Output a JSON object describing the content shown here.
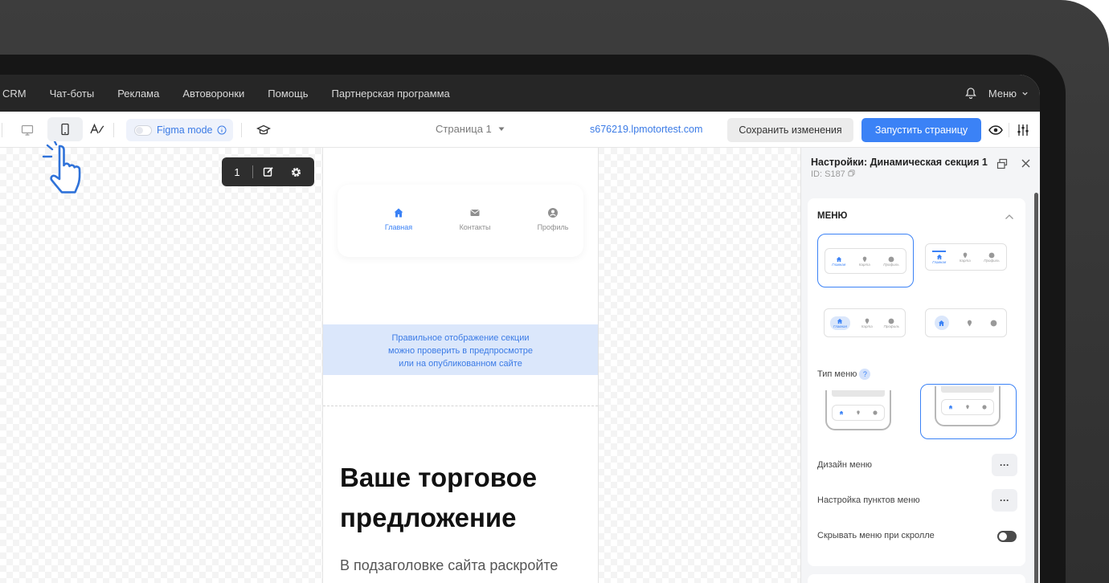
{
  "topnav": {
    "items": [
      "CRM",
      "Чат-боты",
      "Реклама",
      "Автоворонки",
      "Помощь",
      "Партнерская программа"
    ],
    "menu_label": "Меню"
  },
  "toolbar": {
    "figma_mode": "Figma mode",
    "page_select": "Страница 1",
    "domain": "s676219.lpmotortest.com",
    "save_label": "Сохранить изменения",
    "launch_label": "Запустить страницу"
  },
  "float_toolbar": {
    "number": "1"
  },
  "preview": {
    "menu_items": [
      {
        "label": "Главная",
        "icon": "home-icon",
        "active": true
      },
      {
        "label": "Контакты",
        "icon": "envelope-icon",
        "active": false
      },
      {
        "label": "Профиль",
        "icon": "user-circle-icon",
        "active": false
      }
    ],
    "info_line1": "Правильное отображение секции",
    "info_line2": "можно проверить в предпросмотре",
    "info_line3": "или на опубликованном сайте",
    "hero_title_1": "Ваше торговое",
    "hero_title_2": "предложение",
    "hero_subtitle": "В подзаголовке сайта раскройте"
  },
  "panel": {
    "title": "Настройки: Динамическая секция 1",
    "id": "ID: S187",
    "section_title": "МЕНЮ",
    "mini_labels": [
      "Главная",
      "Карта",
      "Профиль"
    ],
    "menu_type_label": "Тип меню",
    "menu_type_help": "?",
    "design_label": "Дизайн меню",
    "items_label": "Настройка пунктов меню",
    "hide_label": "Скрывать меню при скролле",
    "dots": "···"
  },
  "colors": {
    "accent": "#3b82f6",
    "nav_bg": "#262626",
    "info_band": "#dbe7fb"
  }
}
